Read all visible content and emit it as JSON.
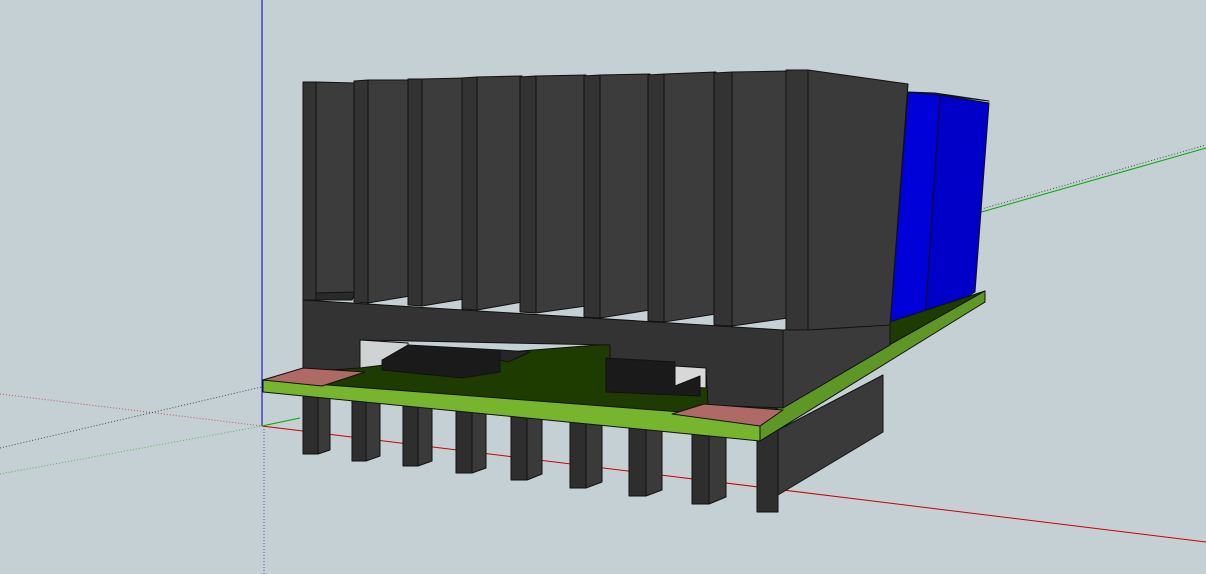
{
  "app": {
    "window_title": ""
  },
  "scene": {
    "background_color": "#c4d0d3",
    "axes": {
      "red_axis_color": "#cc0000",
      "green_axis_color": "#00aa00",
      "blue_axis_color": "#0000cc"
    },
    "model": {
      "heatsink_color": "#333333",
      "heatsink_fin_count": 9,
      "heatsink_lower_fin_count": 9,
      "pcb_top_color": "#1e3c00",
      "pcb_edge_color": "#6ca32c",
      "pad_color": "#b06a66",
      "component_color": "#1a1a1a",
      "blue_block_color": "#0000d8"
    }
  }
}
